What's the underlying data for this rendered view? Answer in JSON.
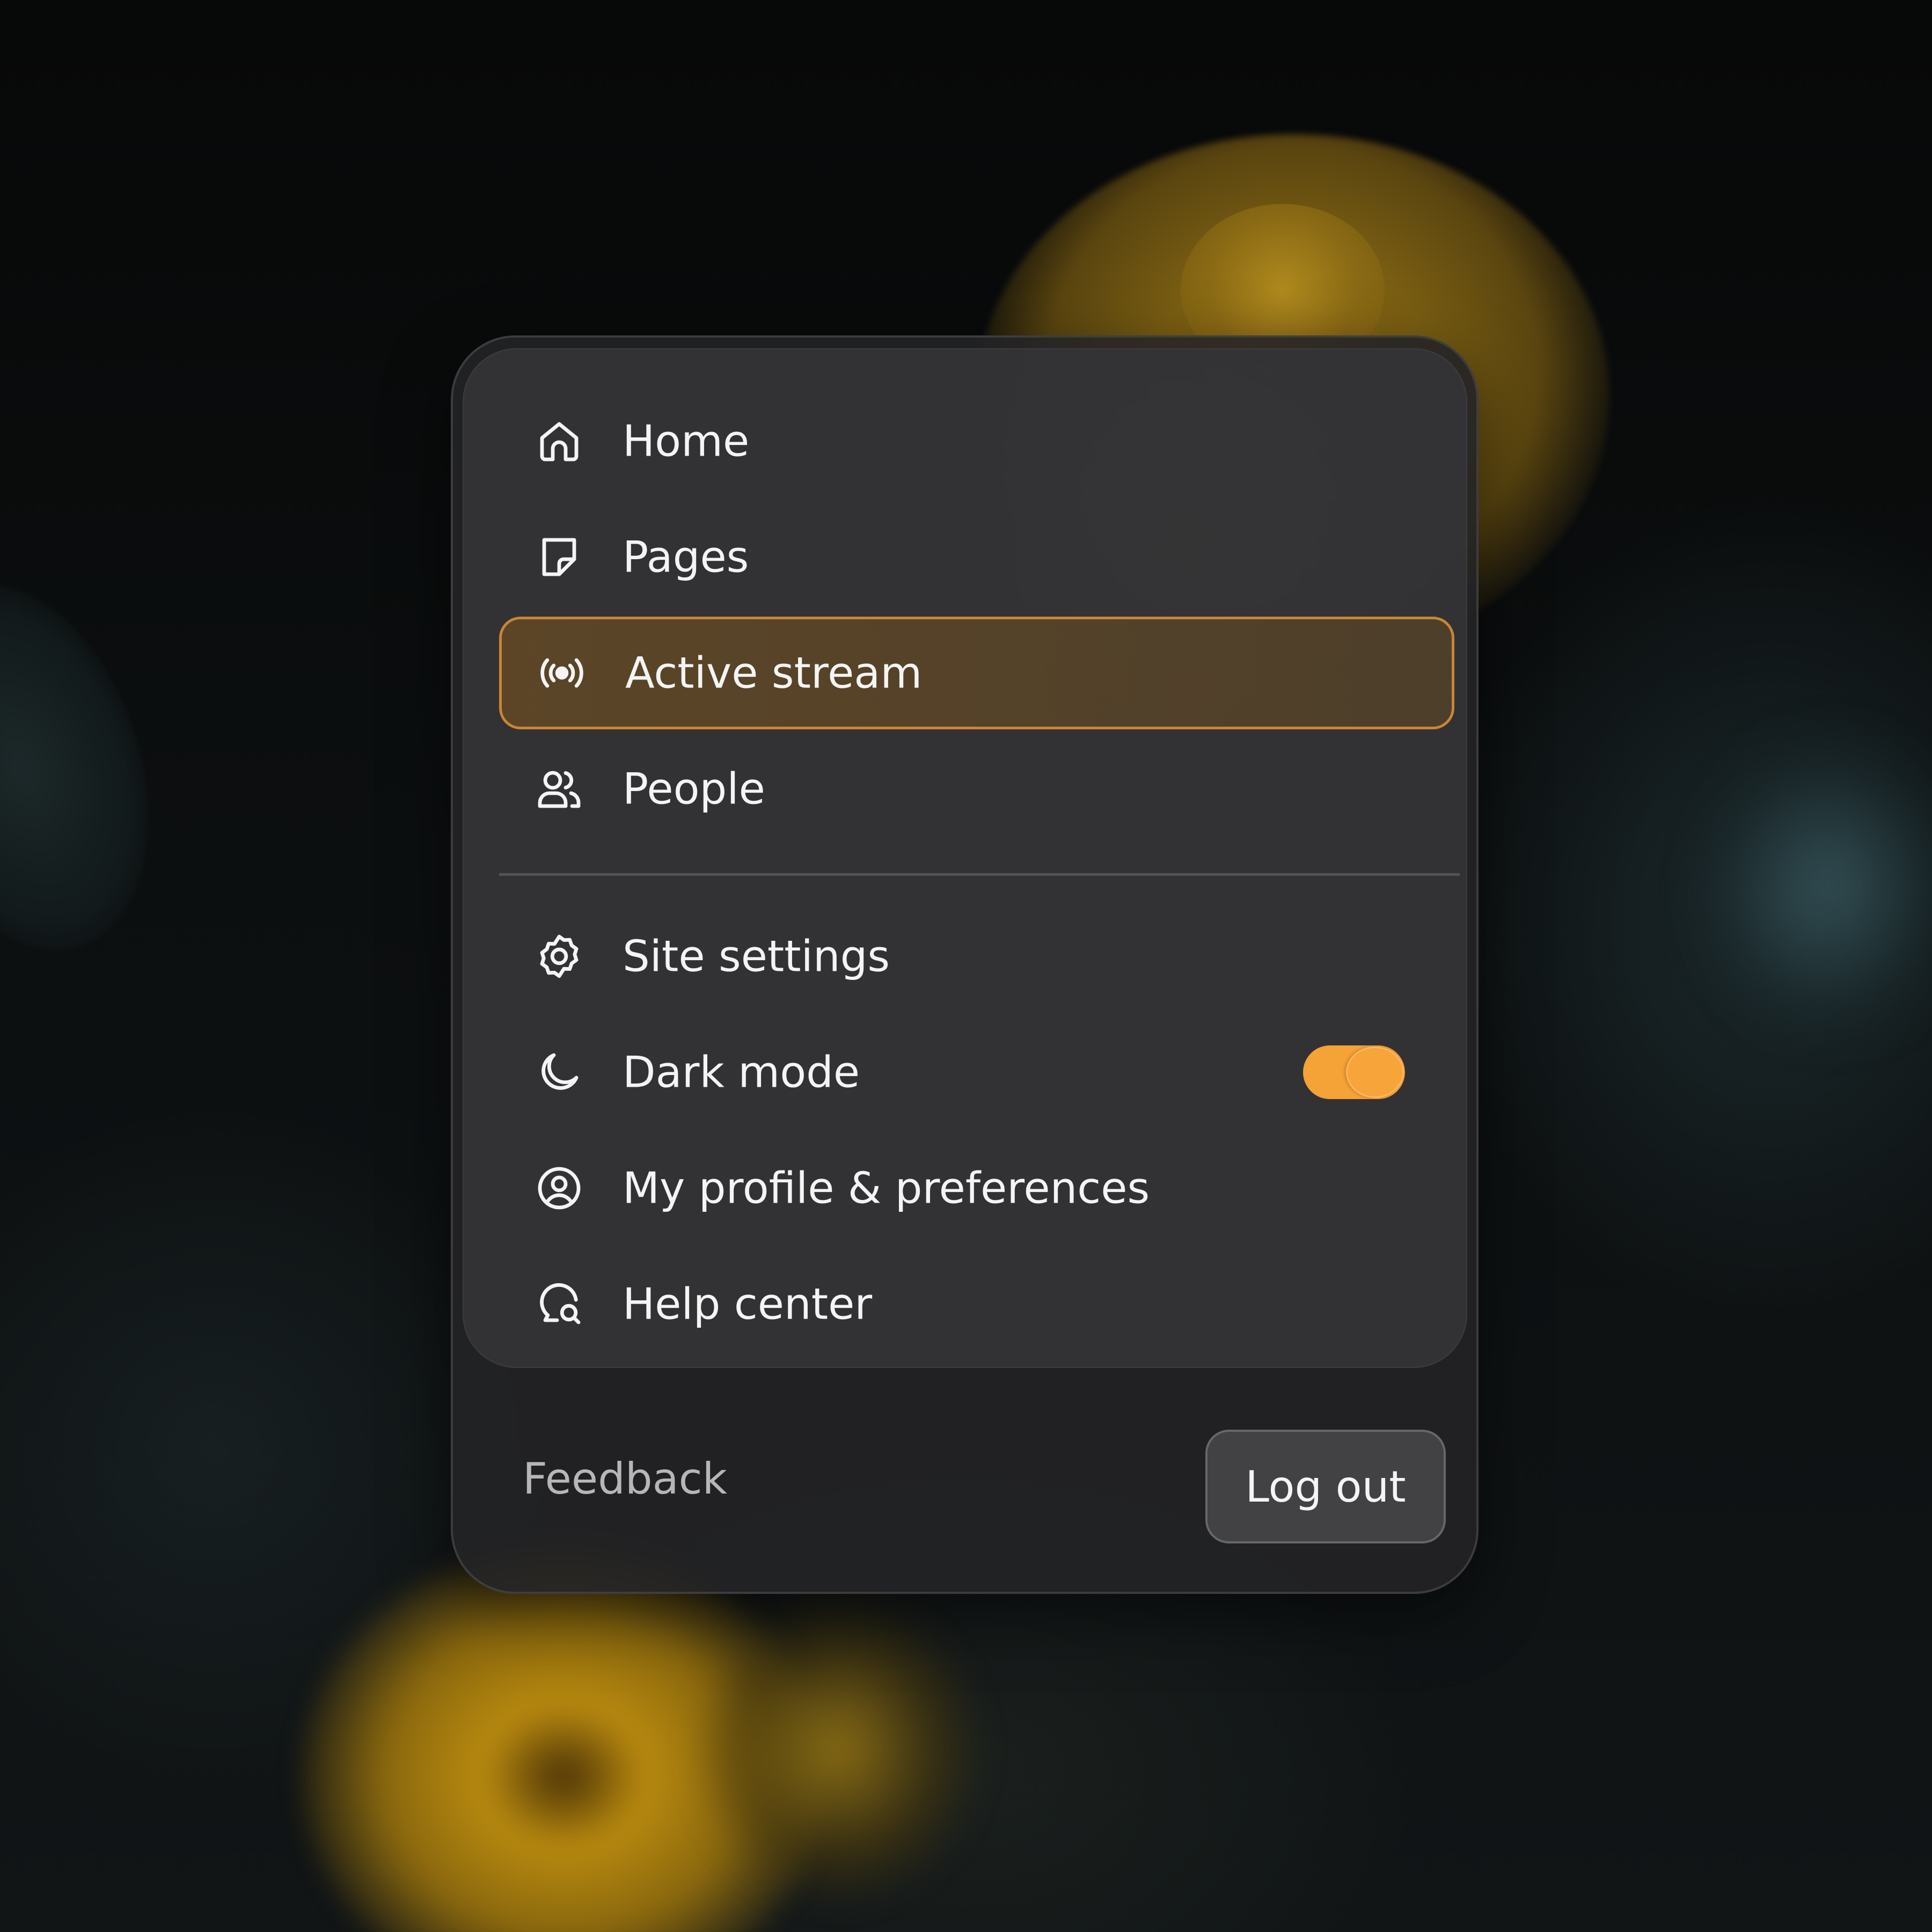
{
  "menu": {
    "items": [
      {
        "label": "Home",
        "icon": "home-icon"
      },
      {
        "label": "Pages",
        "icon": "page-icon"
      },
      {
        "label": "Active stream",
        "icon": "broadcast-icon",
        "active": true
      },
      {
        "label": "People",
        "icon": "people-icon"
      },
      {
        "label": "Site settings",
        "icon": "gear-icon"
      },
      {
        "label": "Dark mode",
        "icon": "moon-icon",
        "toggle": true,
        "toggle_on": true
      },
      {
        "label": "My profile & preferences",
        "icon": "user-circle-icon"
      },
      {
        "label": "Help center",
        "icon": "chat-search-icon"
      }
    ]
  },
  "footer": {
    "feedback_label": "Feedback",
    "logout_label": "Log out"
  },
  "colors": {
    "accent": "#f5a236",
    "active_border": "#c98534",
    "text": "#f4f4f4",
    "muted_text": "#b6b6b8"
  }
}
